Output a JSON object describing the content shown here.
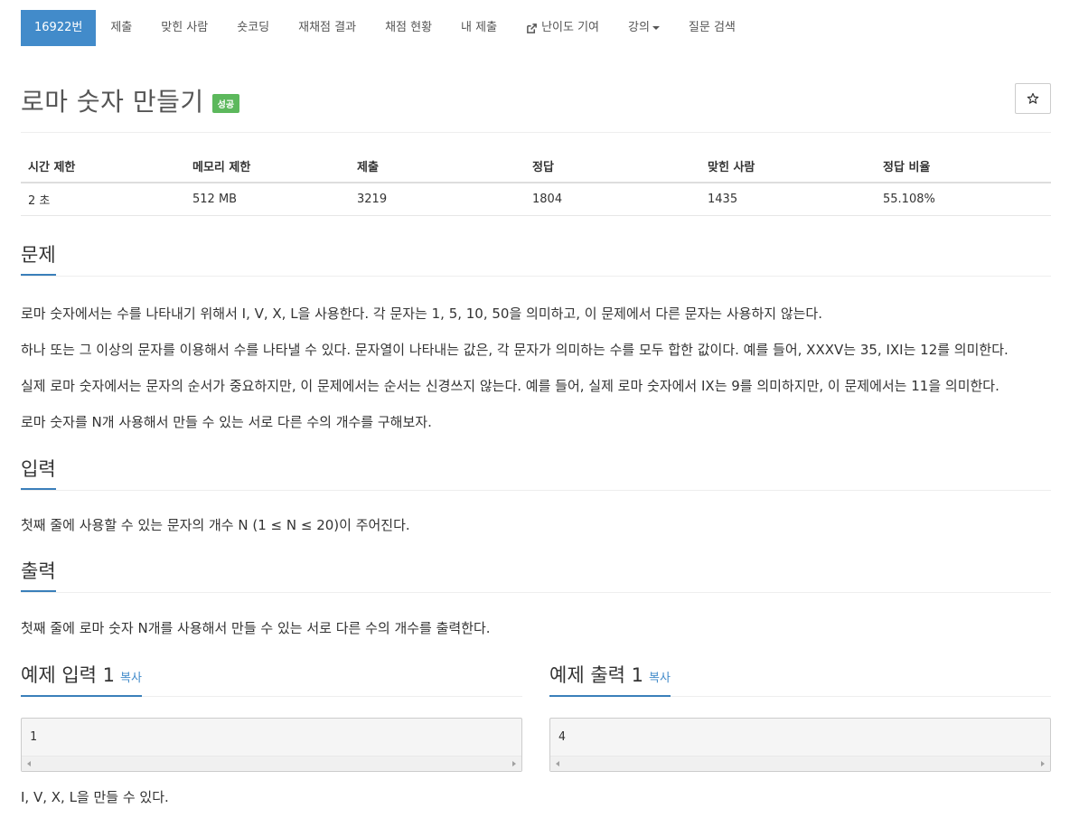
{
  "nav": {
    "items": [
      {
        "label": "16922번",
        "active": true
      },
      {
        "label": "제출"
      },
      {
        "label": "맞힌 사람"
      },
      {
        "label": "숏코딩"
      },
      {
        "label": "재채점 결과"
      },
      {
        "label": "채점 현황"
      },
      {
        "label": "내 제출"
      },
      {
        "label": "난이도 기여",
        "icon": "external-link-icon"
      },
      {
        "label": "강의",
        "dropdown": true
      },
      {
        "label": "질문 검색"
      }
    ]
  },
  "problem": {
    "title": "로마 숫자 만들기",
    "status_badge": "성공",
    "star_icon": "☆"
  },
  "info_table": {
    "headers": [
      "시간 제한",
      "메모리 제한",
      "제출",
      "정답",
      "맞힌 사람",
      "정답 비율"
    ],
    "row": [
      "2 초",
      "512 MB",
      "3219",
      "1804",
      "1435",
      "55.108%"
    ]
  },
  "description": {
    "heading": "문제",
    "paragraphs": [
      "로마 숫자에서는 수를 나타내기 위해서 I, V, X, L을 사용한다. 각 문자는 1, 5, 10, 50을 의미하고, 이 문제에서 다른 문자는 사용하지 않는다.",
      "하나 또는 그 이상의 문자를 이용해서 수를 나타낼 수 있다. 문자열이 나타내는 값은, 각 문자가 의미하는 수를 모두 합한 값이다. 예를 들어, XXXV는 35, IXI는 12를 의미한다.",
      "실제 로마 숫자에서는 문자의 순서가 중요하지만, 이 문제에서는 순서는 신경쓰지 않는다. 예를 들어, 실제 로마 숫자에서 IX는 9를 의미하지만, 이 문제에서는 11을 의미한다.",
      "로마 숫자를 N개 사용해서 만들 수 있는 서로 다른 수의 개수를 구해보자."
    ]
  },
  "input_section": {
    "heading": "입력",
    "text": "첫째 줄에 사용할 수 있는 문자의 개수 N (1 ≤ N ≤ 20)이 주어진다."
  },
  "output_section": {
    "heading": "출력",
    "text": "첫째 줄에 로마 숫자 N개를 사용해서 만들 수 있는 서로 다른 수의 개수를 출력한다."
  },
  "samples": {
    "input_heading": "예제 입력 1",
    "output_heading": "예제 출력 1",
    "copy_label": "복사",
    "input_value": "1",
    "output_value": "4",
    "note": "I, V, X, L을 만들 수 있다."
  }
}
